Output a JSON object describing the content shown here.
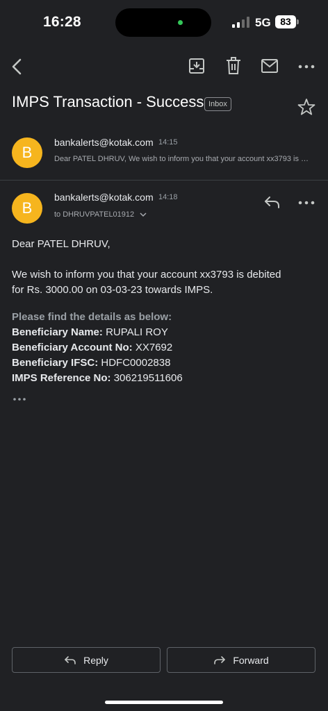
{
  "status_bar": {
    "time": "16:28",
    "network": "5G",
    "battery": "83"
  },
  "toolbar": {
    "back_icon": "chevron-left-icon",
    "archive_icon": "archive-icon",
    "delete_icon": "trash-icon",
    "mark_unread_icon": "mail-icon",
    "more_icon": "more-horizontal-icon"
  },
  "email": {
    "subject": "IMPS Transaction - Success",
    "label": "Inbox",
    "star_icon": "star-outline-icon"
  },
  "messages": [
    {
      "avatar_letter": "B",
      "sender": "bankalerts@kotak.com",
      "time": "14:15",
      "snippet": "Dear PATEL DHRUV, We wish to inform you that your account xx3793 is debited for Rs. 3000.00"
    },
    {
      "avatar_letter": "B",
      "sender": "bankalerts@kotak.com",
      "time": "14:18",
      "recipient": "to DHRUVPATEL01912",
      "body": {
        "greeting": "Dear PATEL DHRUV,",
        "line1": "We wish to inform you that your account xx3793 is debited",
        "line2": "for Rs. 3000.00 on 03-03-23 towards IMPS.",
        "details_heading": "Please find the details as below:",
        "details": [
          {
            "label": "Beneficiary Name:",
            "value": "RUPALI ROY"
          },
          {
            "label": "Beneficiary Account No:",
            "value": "XX7692"
          },
          {
            "label": "Beneficiary IFSC:",
            "value": "HDFC0002838"
          },
          {
            "label": "IMPS Reference No:",
            "value": "306219511606"
          }
        ]
      }
    }
  ],
  "actions": {
    "reply_label": "Reply",
    "forward_label": "Forward"
  },
  "colors": {
    "background": "#202124",
    "avatar": "#f6b51e",
    "online_dot": "#34c759"
  }
}
